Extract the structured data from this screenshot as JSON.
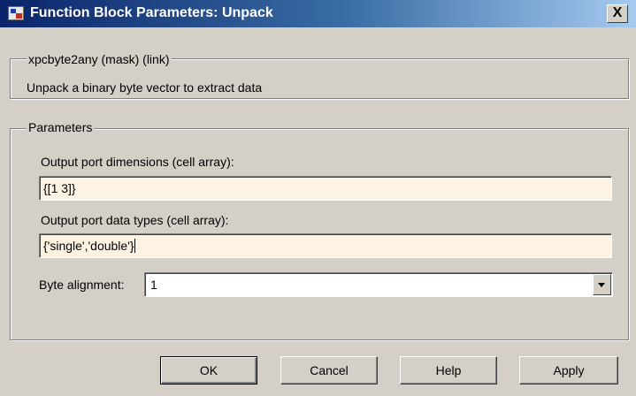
{
  "window": {
    "title": "Function Block Parameters: Unpack",
    "close_label": "X"
  },
  "description_group": {
    "legend": "xpcbyte2any (mask) (link)",
    "text": "Unpack a binary byte vector to extract data"
  },
  "parameters_group": {
    "legend": "Parameters",
    "output_port_dimensions": {
      "label": "Output port dimensions (cell array):",
      "value": "{[1 3]}"
    },
    "output_port_data_types": {
      "label": "Output port data types (cell array):",
      "value": "{'single','double'}"
    },
    "byte_alignment": {
      "label": "Byte alignment:",
      "value": "1"
    }
  },
  "buttons": {
    "ok": "OK",
    "cancel": "Cancel",
    "help": "Help",
    "apply": "Apply"
  },
  "colors": {
    "titlebar_start": "#0a246a",
    "titlebar_end": "#a6caf0",
    "dialog_bg": "#d4d0c8",
    "field_bg": "#fdf3e3"
  }
}
